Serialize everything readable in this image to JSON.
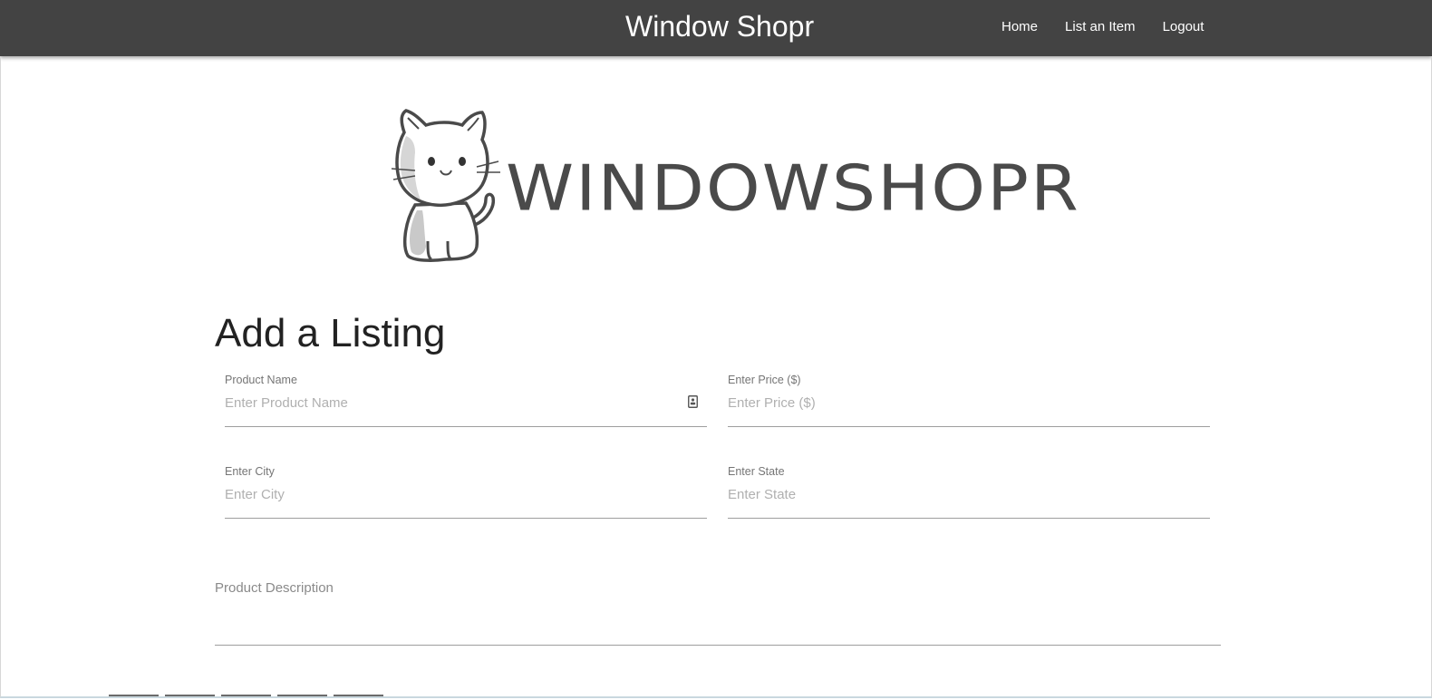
{
  "navbar": {
    "brand": "Window Shopr",
    "links": [
      {
        "label": "Home"
      },
      {
        "label": "List an Item"
      },
      {
        "label": "Logout"
      }
    ]
  },
  "logo": {
    "text": "WINDOWSHOPR",
    "icon": "cat-mascot-icon",
    "color": "#4a4a4a"
  },
  "form": {
    "title": "Add a Listing",
    "product_name": {
      "label": "Product Name",
      "placeholder": "Enter Product Name",
      "value": "",
      "icon": "contact-card-icon"
    },
    "price": {
      "label": "Enter Price ($)",
      "placeholder": "Enter Price ($)",
      "value": ""
    },
    "city": {
      "label": "Enter City",
      "placeholder": "Enter City",
      "value": ""
    },
    "state": {
      "label": "Enter State",
      "placeholder": "Enter State",
      "value": ""
    },
    "description": {
      "label": "Product Description",
      "value": ""
    }
  },
  "colors": {
    "navbar_bg": "#434343",
    "navbar_text": "#ffffff",
    "field_underline": "#9e9e9e",
    "placeholder": "#b0b0b0"
  }
}
